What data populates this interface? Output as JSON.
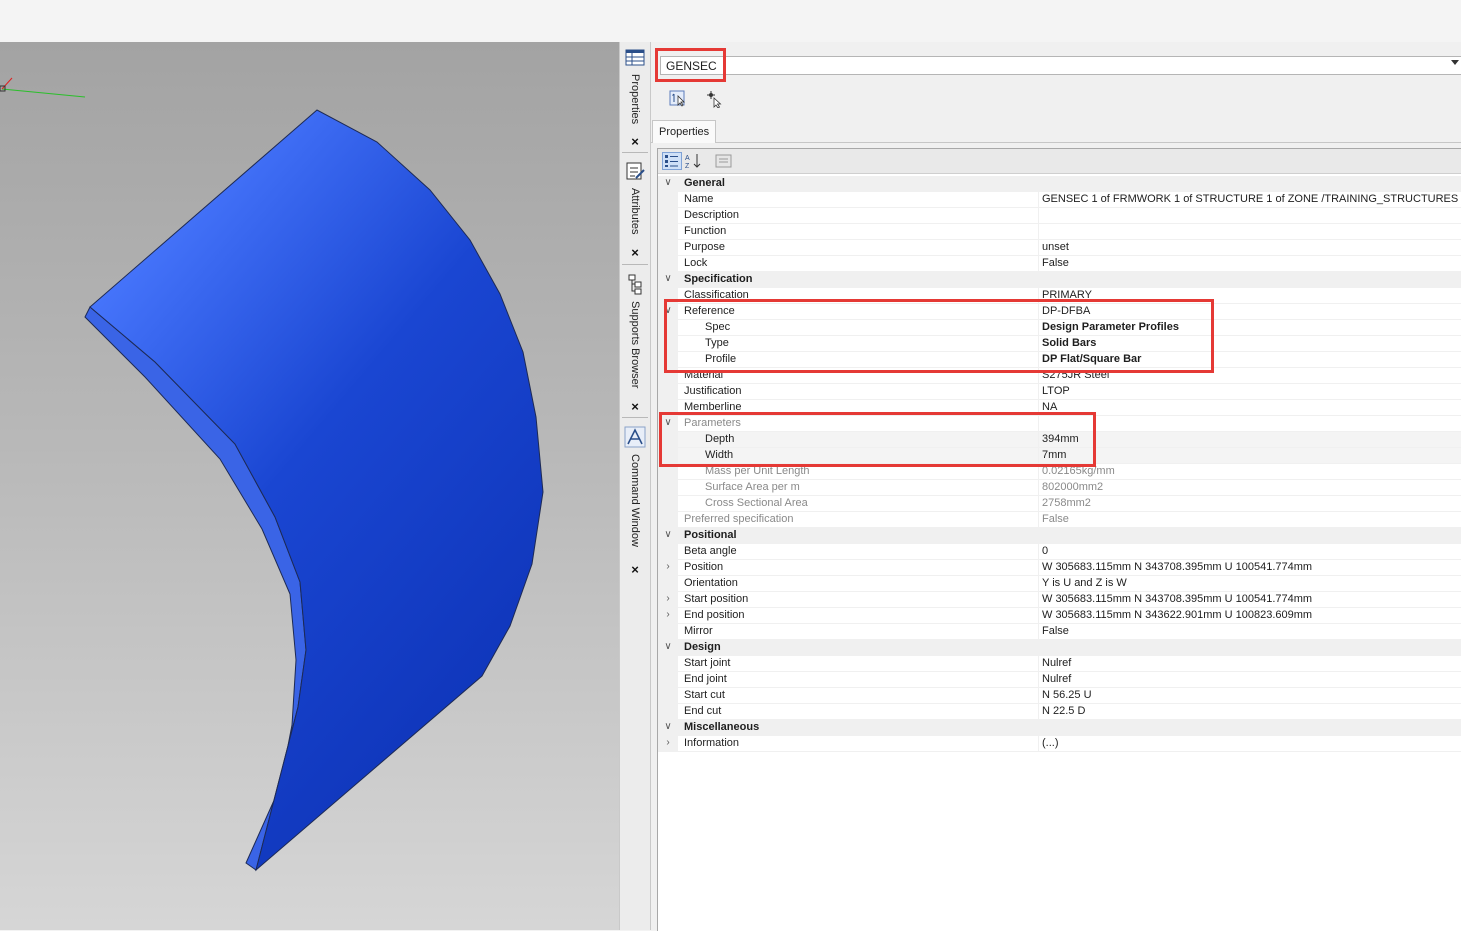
{
  "side_tabs": [
    {
      "label": "Properties",
      "icon": "properties-grid-icon"
    },
    {
      "label": "Attributes",
      "icon": "attributes-icon"
    },
    {
      "label": "Supports Browser",
      "icon": "tree-icon"
    },
    {
      "label": "Command Window",
      "icon": "command-a-icon"
    }
  ],
  "close_glyph": "×",
  "panel": {
    "selector_value": "GENSEC",
    "tab_label": "Properties"
  },
  "colors": {
    "shape_top": "#4a79ff",
    "shape_bottom": "#0e34b8",
    "highlight": "#e53935"
  },
  "grid": {
    "categories": [
      {
        "key": "general",
        "label": "General",
        "rows": [
          {
            "key": "name",
            "label": "Name",
            "value": "GENSEC 1 of FRMWORK 1 of STRUCTURE 1 of ZONE /TRAINING_STRUCTURES"
          },
          {
            "key": "description",
            "label": "Description",
            "value": ""
          },
          {
            "key": "function",
            "label": "Function",
            "value": ""
          },
          {
            "key": "purpose",
            "label": "Purpose",
            "value": "unset"
          },
          {
            "key": "lock",
            "label": "Lock",
            "value": "False"
          }
        ]
      },
      {
        "key": "specification",
        "label": "Specification",
        "rows": [
          {
            "key": "classification",
            "label": "Classification",
            "value": "PRIMARY"
          },
          {
            "key": "reference",
            "label": "Reference",
            "value": "DP-DFBA",
            "expander": "open"
          },
          {
            "key": "spec",
            "label": "Spec",
            "value": "Design Parameter Profiles",
            "indent": true,
            "bold_value": true
          },
          {
            "key": "type",
            "label": "Type",
            "value": "Solid Bars",
            "indent": true,
            "bold_value": true
          },
          {
            "key": "profile",
            "label": "Profile",
            "value": "DP Flat/Square Bar",
            "indent": true,
            "bold_value": true
          },
          {
            "key": "material",
            "label": "Material",
            "value": "S275JR Steel"
          },
          {
            "key": "justification",
            "label": "Justification",
            "value": "LTOP"
          },
          {
            "key": "memberline",
            "label": "Memberline",
            "value": "NA"
          },
          {
            "key": "parameters",
            "label": "Parameters",
            "value": "",
            "expander": "open",
            "dim": true
          },
          {
            "key": "depth",
            "label": "Depth",
            "value": "394mm",
            "indent": true,
            "shade": true
          },
          {
            "key": "width",
            "label": "Width",
            "value": "7mm",
            "indent": true,
            "shade": true
          },
          {
            "key": "mass_per_unit_length",
            "label": "Mass per Unit Length",
            "value": "0.02165kg/mm",
            "indent": true,
            "dim": true
          },
          {
            "key": "surface_area_per_m",
            "label": "Surface Area per m",
            "value": "802000mm2",
            "indent": true,
            "dim": true
          },
          {
            "key": "cross_sectional_area",
            "label": "Cross Sectional Area",
            "value": "2758mm2",
            "indent": true,
            "dim": true
          },
          {
            "key": "preferred_specification",
            "label": "Preferred specification",
            "value": "False",
            "dim": true
          }
        ]
      },
      {
        "key": "positional",
        "label": "Positional",
        "rows": [
          {
            "key": "beta_angle",
            "label": "Beta angle",
            "value": "0"
          },
          {
            "key": "position",
            "label": "Position",
            "value": "W 305683.115mm N 343708.395mm U 100541.774mm",
            "expander": "closed"
          },
          {
            "key": "orientation",
            "label": "Orientation",
            "value": "Y is U and Z is W"
          },
          {
            "key": "start_position",
            "label": "Start position",
            "value": "W 305683.115mm N 343708.395mm U 100541.774mm",
            "expander": "closed"
          },
          {
            "key": "end_position",
            "label": "End position",
            "value": "W 305683.115mm N 343622.901mm U 100823.609mm",
            "expander": "closed"
          },
          {
            "key": "mirror",
            "label": "Mirror",
            "value": "False"
          }
        ]
      },
      {
        "key": "design",
        "label": "Design",
        "rows": [
          {
            "key": "start_joint",
            "label": "Start joint",
            "value": "Nulref"
          },
          {
            "key": "end_joint",
            "label": "End joint",
            "value": "Nulref"
          },
          {
            "key": "start_cut",
            "label": "Start cut",
            "value": "N 56.25 U"
          },
          {
            "key": "end_cut",
            "label": "End cut",
            "value": "N 22.5 D"
          }
        ]
      },
      {
        "key": "miscellaneous",
        "label": "Miscellaneous",
        "rows": [
          {
            "key": "information",
            "label": "Information",
            "value": "(...)",
            "expander": "closed"
          }
        ]
      }
    ]
  }
}
